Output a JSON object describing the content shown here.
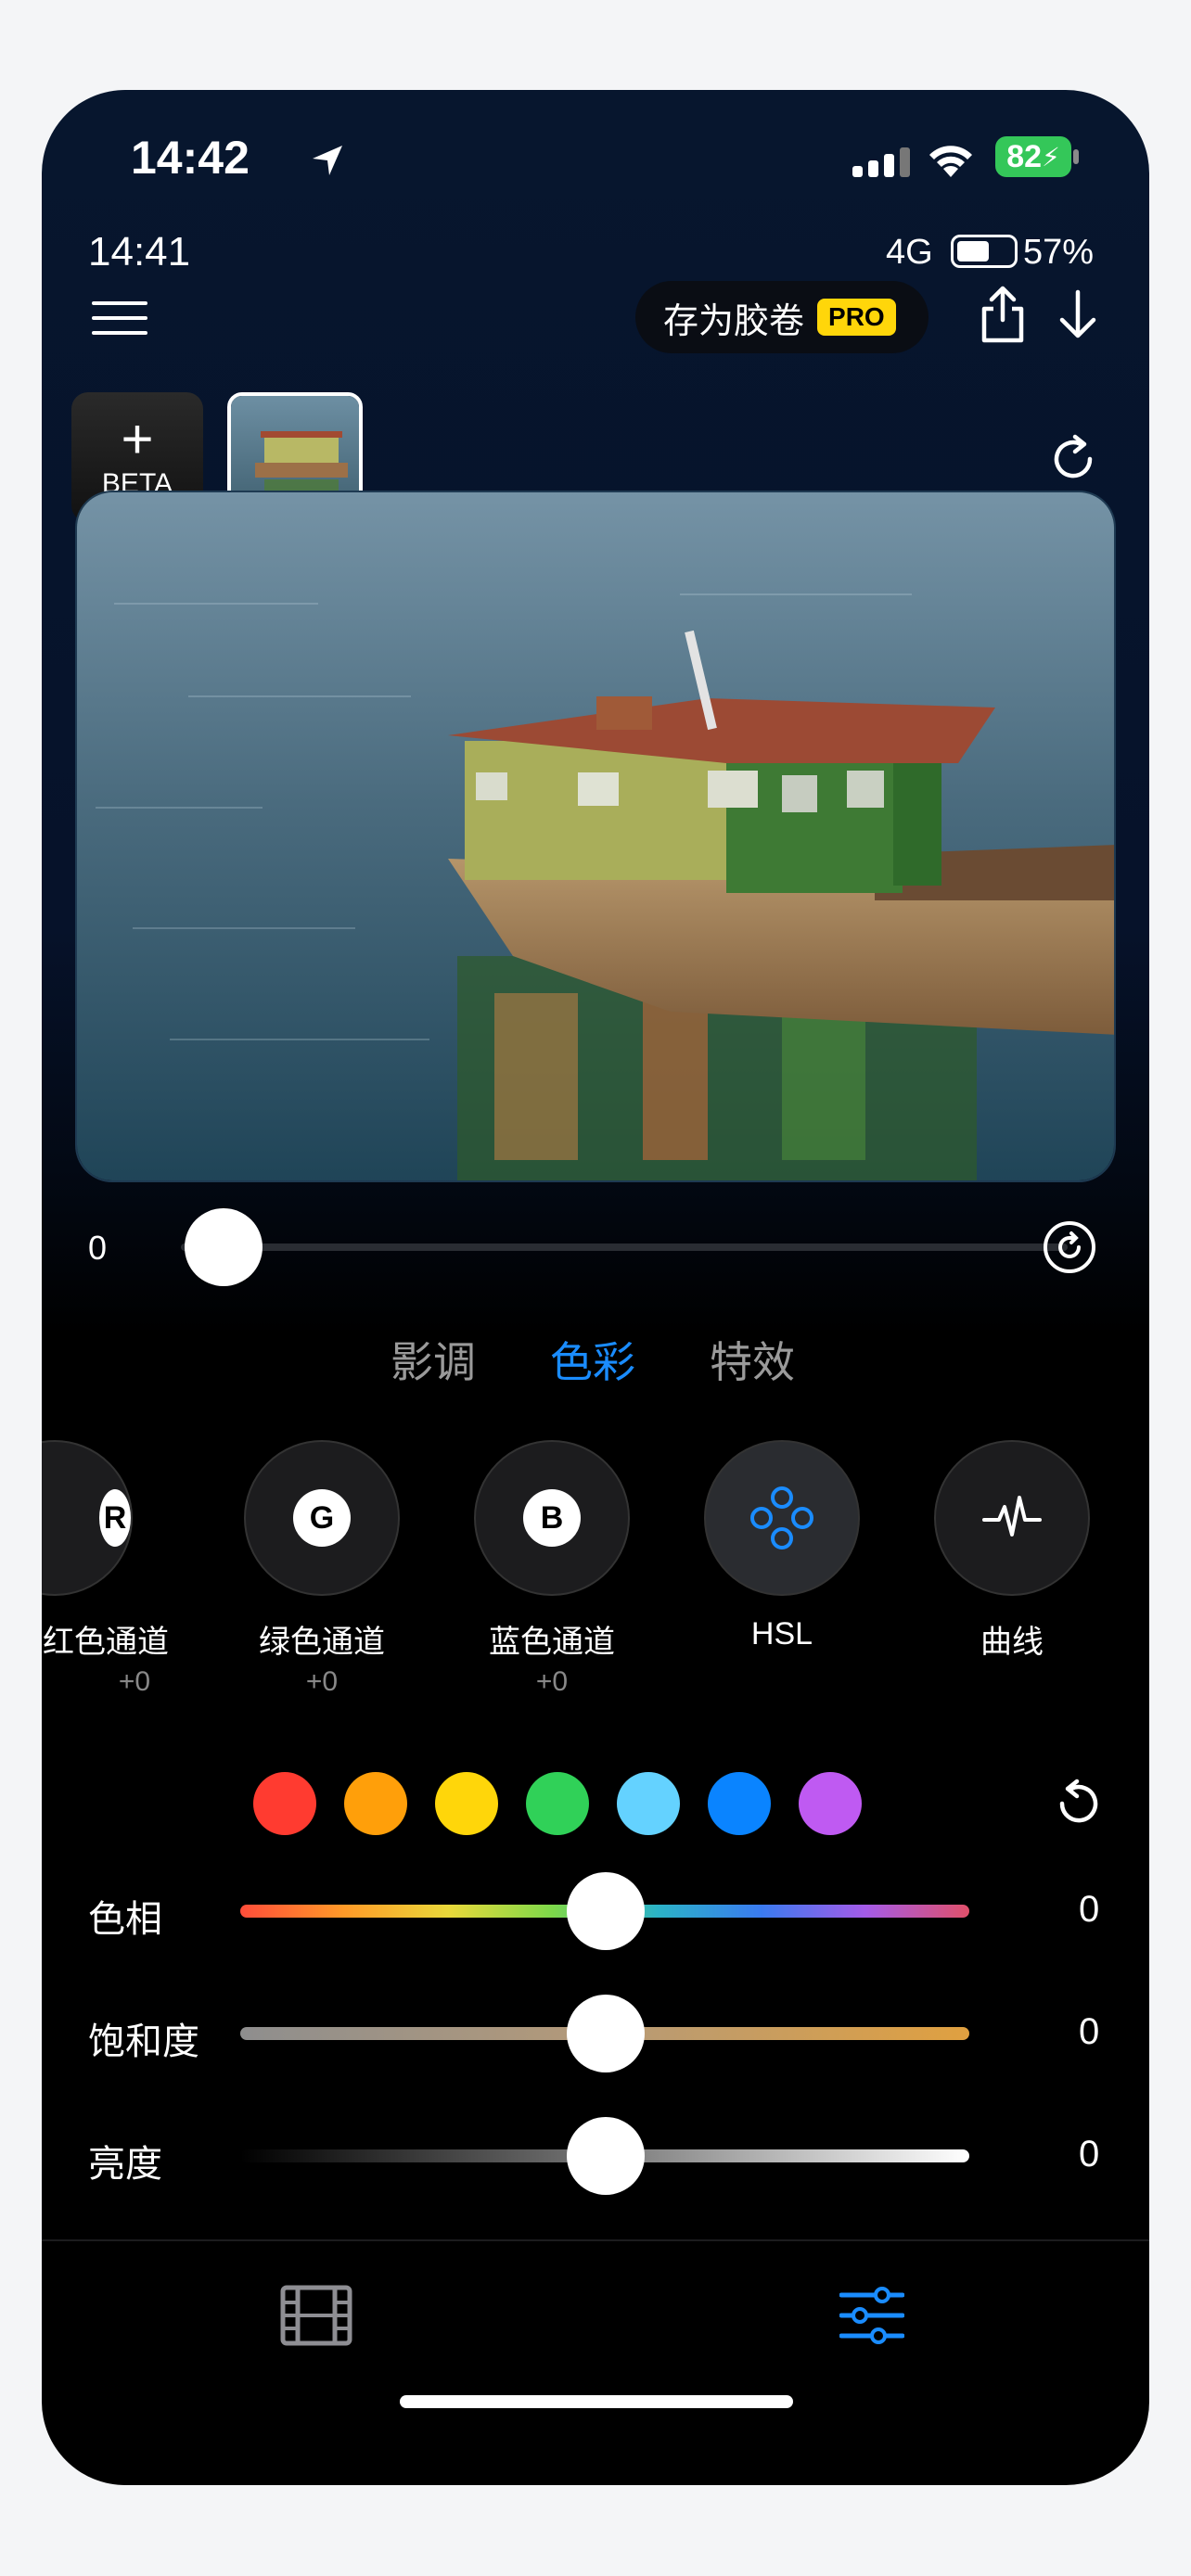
{
  "status_bar": {
    "time": "14:42",
    "battery": "82"
  },
  "inner_status": {
    "time": "14:41",
    "network": "4G",
    "battery_pct": "57%",
    "battery_level": 0.57
  },
  "toolbar": {
    "save_label": "存为胶卷",
    "pro_badge": "PRO"
  },
  "thumbs": {
    "add_label": "BETA"
  },
  "intensity": {
    "value": "0",
    "level": 0
  },
  "tabs": [
    {
      "label": "影调",
      "active": false
    },
    {
      "label": "色彩",
      "active": true
    },
    {
      "label": "特效",
      "active": false
    }
  ],
  "tools": [
    {
      "badge": "R",
      "label": "红色通道",
      "value": "+0"
    },
    {
      "badge": "G",
      "label": "绿色通道",
      "value": "+0"
    },
    {
      "badge": "B",
      "label": "蓝色通道",
      "value": "+0"
    },
    {
      "label": "HSL",
      "icon": "hsl-icon"
    },
    {
      "label": "曲线",
      "icon": "curve-icon"
    }
  ],
  "color_swatches": [
    "#ff3b30",
    "#ff9f0a",
    "#ffd60a",
    "#30d158",
    "#64d2ff",
    "#0a84ff",
    "#bf5af2"
  ],
  "hsl_sliders": [
    {
      "label": "色相",
      "value": "0",
      "level": 0
    },
    {
      "label": "饱和度",
      "value": "0",
      "level": 0
    },
    {
      "label": "亮度",
      "value": "0",
      "level": 0
    }
  ],
  "bottom_nav": [
    {
      "icon": "film-icon",
      "active": false
    },
    {
      "icon": "adjust-icon",
      "active": true
    }
  ],
  "colors": {
    "accent": "#1a8cff",
    "pro": "#ffd60a",
    "battery": "#34c759"
  }
}
